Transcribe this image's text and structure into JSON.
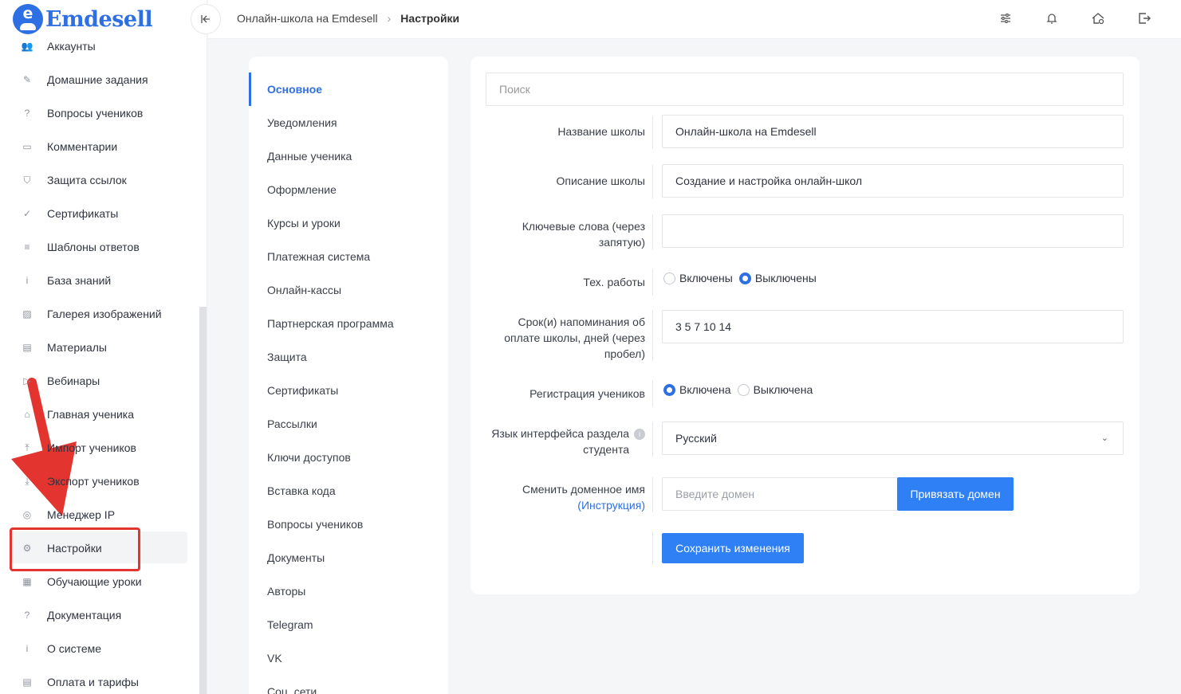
{
  "brand": {
    "name": "Emdesell",
    "logo_letter": "e"
  },
  "sidebar": {
    "items": [
      {
        "label": "Аккаунты",
        "icon": "users-icon",
        "glyph": "👥"
      },
      {
        "label": "Домашние задания",
        "icon": "pencil-icon",
        "glyph": "✎"
      },
      {
        "label": "Вопросы учеников",
        "icon": "question-icon",
        "glyph": "?"
      },
      {
        "label": "Комментарии",
        "icon": "comment-icon",
        "glyph": "▭"
      },
      {
        "label": "Защита ссылок",
        "icon": "shield-icon",
        "glyph": "⛉"
      },
      {
        "label": "Сертификаты",
        "icon": "check-circle-icon",
        "glyph": "✓"
      },
      {
        "label": "Шаблоны ответов",
        "icon": "list-icon",
        "glyph": "≡"
      },
      {
        "label": "База знаний",
        "icon": "info-icon",
        "glyph": "i"
      },
      {
        "label": "Галерея изображений",
        "icon": "image-icon",
        "glyph": "▨"
      },
      {
        "label": "Материалы",
        "icon": "box-icon",
        "glyph": "▤"
      },
      {
        "label": "Вебинары",
        "icon": "play-icon",
        "glyph": "▷"
      },
      {
        "label": "Главная ученика",
        "icon": "home-icon",
        "glyph": "⌂"
      },
      {
        "label": "Импорт учеников",
        "icon": "upload-icon",
        "glyph": "⤒"
      },
      {
        "label": "Экспорт учеников",
        "icon": "download-icon",
        "glyph": "⤓"
      },
      {
        "label": "Менеджер IP",
        "icon": "target-icon",
        "glyph": "◎"
      },
      {
        "label": "Настройки",
        "icon": "gear-icon",
        "glyph": "⚙"
      },
      {
        "label": "Обучающие уроки",
        "icon": "film-icon",
        "glyph": "▦"
      },
      {
        "label": "Документация",
        "icon": "help-box-icon",
        "glyph": "?"
      },
      {
        "label": "О системе",
        "icon": "info-box-icon",
        "glyph": "i"
      },
      {
        "label": "Оплата и тарифы",
        "icon": "receipt-icon",
        "glyph": "▤"
      }
    ],
    "active_index": 15
  },
  "header": {
    "breadcrumb": [
      "Онлайн-школа на Emdesell",
      "Настройки"
    ],
    "icons": [
      "sliders-icon",
      "bell-icon",
      "home-settings-icon",
      "logout-icon"
    ]
  },
  "settings_nav": {
    "items": [
      "Основное",
      "Уведомления",
      "Данные ученика",
      "Оформление",
      "Курсы и уроки",
      "Платежная система",
      "Онлайн-кассы",
      "Партнерская программа",
      "Защита",
      "Сертификаты",
      "Рассылки",
      "Ключи доступов",
      "Вставка кода",
      "Вопросы учеников",
      "Документы",
      "Авторы",
      "Telegram",
      "VK",
      "Соц. сети"
    ],
    "active_index": 0
  },
  "form": {
    "search_placeholder": "Поиск",
    "school_name": {
      "label": "Название школы",
      "value": "Онлайн-школа на Emdesell"
    },
    "school_description": {
      "label": "Описание школы",
      "value": "Создание и настройка онлайн-школ"
    },
    "keywords": {
      "label_line1": "Ключевые слова (через",
      "label_line2": "запятую)",
      "value": ""
    },
    "maintenance": {
      "label": "Тех. работы",
      "options": [
        "Включены",
        "Выключены"
      ],
      "selected": 1
    },
    "reminder": {
      "label_line1": "Срок(и) напоминания об",
      "label_line2": "оплате школы, дней (через",
      "label_line3": "пробел)",
      "value": "3 5 7 10 14"
    },
    "registration": {
      "label": "Регистрация учеников",
      "options": [
        "Включена",
        "Выключена"
      ],
      "selected": 0
    },
    "language": {
      "label_line1": "Язык интерфейса раздела",
      "label_line2": "студента",
      "info": "i",
      "value": "Русский",
      "chevron": "⌄"
    },
    "domain": {
      "label_line1": "Сменить доменное имя",
      "label_link": "(Инструкция)",
      "placeholder": "Введите домен",
      "button": "Привязать домен"
    },
    "save_button": "Сохранить изменения"
  }
}
